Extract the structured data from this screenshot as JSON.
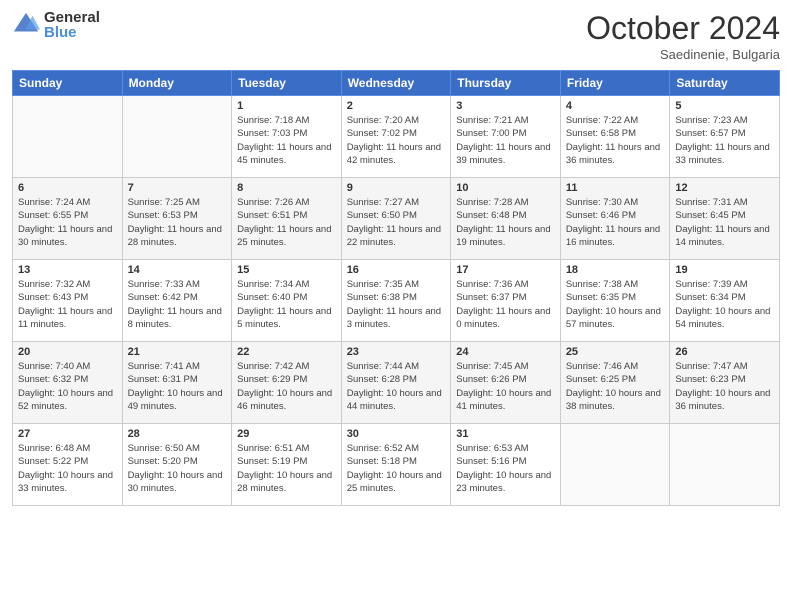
{
  "header": {
    "logo_general": "General",
    "logo_blue": "Blue",
    "month_title": "October 2024",
    "subtitle": "Saedinenie, Bulgaria"
  },
  "days_of_week": [
    "Sunday",
    "Monday",
    "Tuesday",
    "Wednesday",
    "Thursday",
    "Friday",
    "Saturday"
  ],
  "weeks": [
    [
      {
        "day": "",
        "info": ""
      },
      {
        "day": "",
        "info": ""
      },
      {
        "day": "1",
        "info": "Sunrise: 7:18 AM\nSunset: 7:03 PM\nDaylight: 11 hours and 45 minutes."
      },
      {
        "day": "2",
        "info": "Sunrise: 7:20 AM\nSunset: 7:02 PM\nDaylight: 11 hours and 42 minutes."
      },
      {
        "day": "3",
        "info": "Sunrise: 7:21 AM\nSunset: 7:00 PM\nDaylight: 11 hours and 39 minutes."
      },
      {
        "day": "4",
        "info": "Sunrise: 7:22 AM\nSunset: 6:58 PM\nDaylight: 11 hours and 36 minutes."
      },
      {
        "day": "5",
        "info": "Sunrise: 7:23 AM\nSunset: 6:57 PM\nDaylight: 11 hours and 33 minutes."
      }
    ],
    [
      {
        "day": "6",
        "info": "Sunrise: 7:24 AM\nSunset: 6:55 PM\nDaylight: 11 hours and 30 minutes."
      },
      {
        "day": "7",
        "info": "Sunrise: 7:25 AM\nSunset: 6:53 PM\nDaylight: 11 hours and 28 minutes."
      },
      {
        "day": "8",
        "info": "Sunrise: 7:26 AM\nSunset: 6:51 PM\nDaylight: 11 hours and 25 minutes."
      },
      {
        "day": "9",
        "info": "Sunrise: 7:27 AM\nSunset: 6:50 PM\nDaylight: 11 hours and 22 minutes."
      },
      {
        "day": "10",
        "info": "Sunrise: 7:28 AM\nSunset: 6:48 PM\nDaylight: 11 hours and 19 minutes."
      },
      {
        "day": "11",
        "info": "Sunrise: 7:30 AM\nSunset: 6:46 PM\nDaylight: 11 hours and 16 minutes."
      },
      {
        "day": "12",
        "info": "Sunrise: 7:31 AM\nSunset: 6:45 PM\nDaylight: 11 hours and 14 minutes."
      }
    ],
    [
      {
        "day": "13",
        "info": "Sunrise: 7:32 AM\nSunset: 6:43 PM\nDaylight: 11 hours and 11 minutes."
      },
      {
        "day": "14",
        "info": "Sunrise: 7:33 AM\nSunset: 6:42 PM\nDaylight: 11 hours and 8 minutes."
      },
      {
        "day": "15",
        "info": "Sunrise: 7:34 AM\nSunset: 6:40 PM\nDaylight: 11 hours and 5 minutes."
      },
      {
        "day": "16",
        "info": "Sunrise: 7:35 AM\nSunset: 6:38 PM\nDaylight: 11 hours and 3 minutes."
      },
      {
        "day": "17",
        "info": "Sunrise: 7:36 AM\nSunset: 6:37 PM\nDaylight: 11 hours and 0 minutes."
      },
      {
        "day": "18",
        "info": "Sunrise: 7:38 AM\nSunset: 6:35 PM\nDaylight: 10 hours and 57 minutes."
      },
      {
        "day": "19",
        "info": "Sunrise: 7:39 AM\nSunset: 6:34 PM\nDaylight: 10 hours and 54 minutes."
      }
    ],
    [
      {
        "day": "20",
        "info": "Sunrise: 7:40 AM\nSunset: 6:32 PM\nDaylight: 10 hours and 52 minutes."
      },
      {
        "day": "21",
        "info": "Sunrise: 7:41 AM\nSunset: 6:31 PM\nDaylight: 10 hours and 49 minutes."
      },
      {
        "day": "22",
        "info": "Sunrise: 7:42 AM\nSunset: 6:29 PM\nDaylight: 10 hours and 46 minutes."
      },
      {
        "day": "23",
        "info": "Sunrise: 7:44 AM\nSunset: 6:28 PM\nDaylight: 10 hours and 44 minutes."
      },
      {
        "day": "24",
        "info": "Sunrise: 7:45 AM\nSunset: 6:26 PM\nDaylight: 10 hours and 41 minutes."
      },
      {
        "day": "25",
        "info": "Sunrise: 7:46 AM\nSunset: 6:25 PM\nDaylight: 10 hours and 38 minutes."
      },
      {
        "day": "26",
        "info": "Sunrise: 7:47 AM\nSunset: 6:23 PM\nDaylight: 10 hours and 36 minutes."
      }
    ],
    [
      {
        "day": "27",
        "info": "Sunrise: 6:48 AM\nSunset: 5:22 PM\nDaylight: 10 hours and 33 minutes."
      },
      {
        "day": "28",
        "info": "Sunrise: 6:50 AM\nSunset: 5:20 PM\nDaylight: 10 hours and 30 minutes."
      },
      {
        "day": "29",
        "info": "Sunrise: 6:51 AM\nSunset: 5:19 PM\nDaylight: 10 hours and 28 minutes."
      },
      {
        "day": "30",
        "info": "Sunrise: 6:52 AM\nSunset: 5:18 PM\nDaylight: 10 hours and 25 minutes."
      },
      {
        "day": "31",
        "info": "Sunrise: 6:53 AM\nSunset: 5:16 PM\nDaylight: 10 hours and 23 minutes."
      },
      {
        "day": "",
        "info": ""
      },
      {
        "day": "",
        "info": ""
      }
    ]
  ]
}
